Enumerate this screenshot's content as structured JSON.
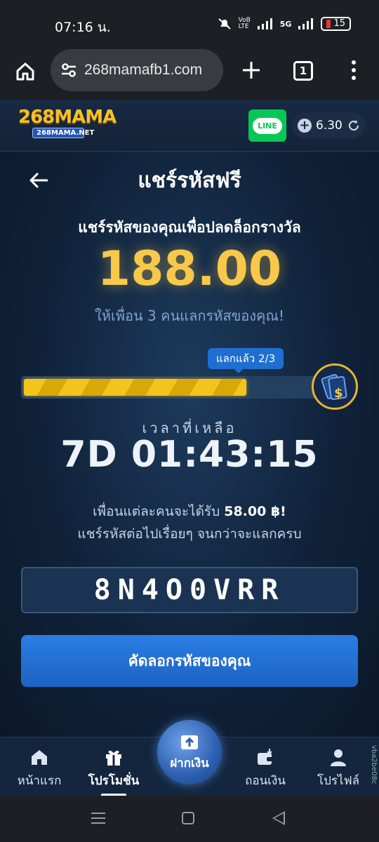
{
  "status_bar": {
    "time": "07:16 น.",
    "network": "5G",
    "battery": "15"
  },
  "browser": {
    "url": "268mamafb1.com",
    "tab_count": "1"
  },
  "site": {
    "logo_main": "268MAMA",
    "logo_sub": "268MAMA.NET",
    "line_label": "LINE",
    "balance": "6.30"
  },
  "page": {
    "title": "แชร์รหัสฟรี",
    "subtitle": "แชร์รหัสของคุณเพื่อปลดล็อกรางวัล",
    "reward_amount": "188.00",
    "invite_text": "ให้เพื่อน 3 คนแลกรหัสของคุณ!",
    "redeemed_label": "แลกแล้ว 2/3",
    "progress_fraction": 0.75,
    "time_left_label": "เวลาที่เหลือ",
    "countdown": "7D 01:43:15",
    "per_friend_prefix": "เพื่อนแต่ละคนจะได้รับ ",
    "per_friend_amount": "58.00 ฿!",
    "keep_sharing": "แชร์รหัสต่อไปเรื่อยๆ จนกว่าจะแลกครบ",
    "share_code": "8N4O0VRR",
    "copy_button": "คัดลอกรหัสของคุณ"
  },
  "bottom_nav": {
    "home": "หน้าแรก",
    "promotions": "โปรโมชั่น",
    "deposit": "ฝากเงิน",
    "withdraw": "ถอนเงิน",
    "profile": "โปรไฟล์"
  },
  "side_tag": "vba2be08c",
  "colors": {
    "accent_gold": "#f7c84a",
    "primary_blue": "#1f6fd1",
    "line_green": "#06c755"
  }
}
